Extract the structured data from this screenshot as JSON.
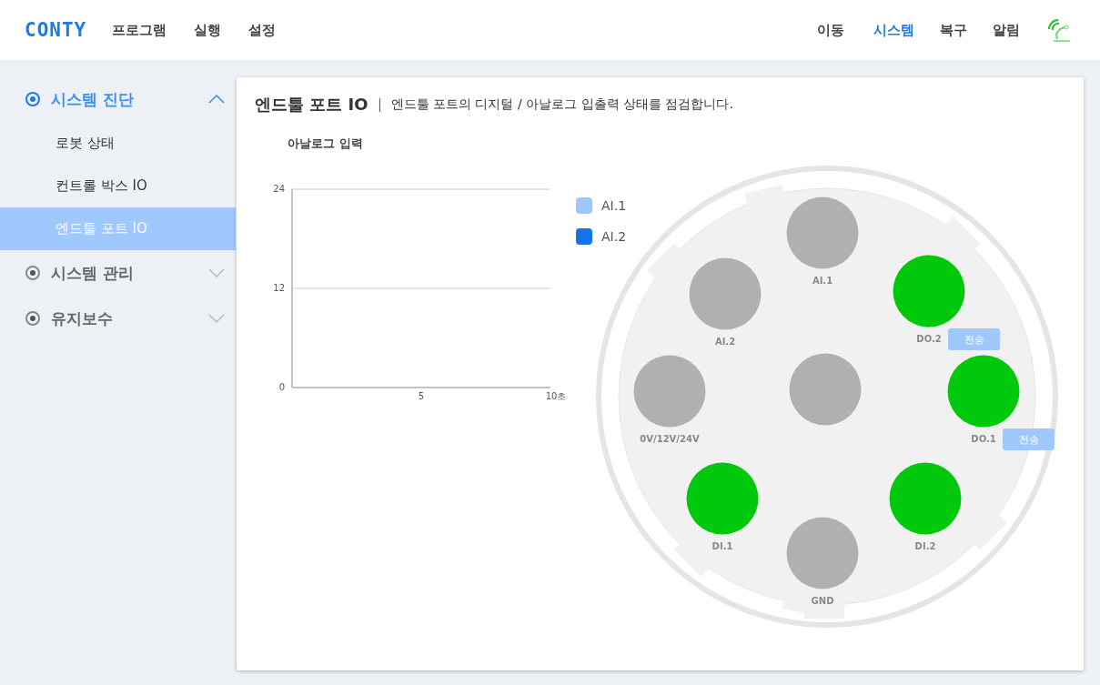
{
  "header": {
    "logo": "CONTY",
    "nav_left": [
      {
        "label": "프로그램",
        "selected": false
      },
      {
        "label": "실행",
        "selected": false
      },
      {
        "label": "설정",
        "selected": false
      }
    ],
    "nav_right": [
      {
        "label": "이동",
        "selected": false
      },
      {
        "label": "시스템",
        "selected": true
      },
      {
        "label": "복구",
        "selected": false
      },
      {
        "label": "알림",
        "selected": false
      }
    ]
  },
  "sidebar": {
    "groups": [
      {
        "label": "시스템 진단",
        "selected": true,
        "expanded": true,
        "children": [
          {
            "label": "로봇 상태",
            "selected": false
          },
          {
            "label": "컨트롤 박스 IO",
            "selected": false
          },
          {
            "label": "엔드툴 포트 IO",
            "selected": true
          }
        ]
      },
      {
        "label": "시스템 관리",
        "selected": false,
        "expanded": false
      },
      {
        "label": "유지보수",
        "selected": false,
        "expanded": false
      }
    ]
  },
  "panel": {
    "title": "엔드툴 포트 IO",
    "description": "엔드툴 포트의 디지털 / 아날로그 입출력 상태를 점검합니다.",
    "chart": {
      "title": "아날로그 입력",
      "y_labels": [
        "24",
        "12",
        "0"
      ],
      "x_labels": [
        "5",
        "10초"
      ],
      "legend": [
        {
          "label": "AI.1",
          "color": "#9ec8fb"
        },
        {
          "label": "AI.2",
          "color": "#1473e6"
        }
      ]
    },
    "pins": [
      {
        "label": "AI.1",
        "on": false
      },
      {
        "label": "AI.2",
        "on": false
      },
      {
        "label": "DO.2",
        "on": true,
        "button": "전송"
      },
      {
        "on": false
      },
      {
        "label": "0V/12V/24V",
        "on": false
      },
      {
        "label": "DO.1",
        "on": true,
        "button": "전송"
      },
      {
        "label": "DI.1",
        "on": true
      },
      {
        "label": "DI.2",
        "on": true
      },
      {
        "label": "GND",
        "on": false
      }
    ]
  }
}
